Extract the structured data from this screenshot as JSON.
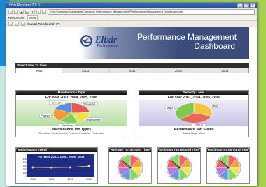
{
  "window": {
    "title": "iHub Reporter 7.0.0"
  },
  "toolbar": {
    "address": "Elixir/Samples/Dashboard/Corporate Performance Management/Performance Management Dashboard.pml"
  },
  "menus": [
    {
      "label": "Perspective"
    },
    {
      "label": "View"
    }
  ],
  "nav": {
    "label": "Overall Trends and KPI"
  },
  "header": {
    "brand": "Elixir",
    "brand_sub": "Technology",
    "title_line1": "Performance Management",
    "title_line2": "Dashboard"
  },
  "year_select": {
    "label": "Select Year To View",
    "years": [
      "2002",
      "2003",
      "2004",
      "2005",
      "2006"
    ]
  },
  "panels": {
    "maintenance_type": {
      "header": "Maintenance Type",
      "title": "For Year 2003, 2004, 2005, 2006",
      "subtitle": "Maintenance Job Types",
      "legend": "Corrective  Enhancement  Planned  Predictive  Preventive",
      "chart_data": {
        "type": "pie",
        "categories": [
          "Preventive",
          "Enhancement",
          "Predictive",
          "Planned",
          "Corrective"
        ],
        "values": [
          24,
          20,
          17,
          21,
          18
        ],
        "colors": [
          "#e85858",
          "#f0e34a",
          "#7bd45a",
          "#f39a3a",
          "#5a8fe0"
        ]
      }
    },
    "severity_level": {
      "header": "Severity Level",
      "title": "For Year 2003, 2004, 2005, 2006",
      "subtitle": "Maintenance Job Status",
      "legend": "Critical  Major  Minor",
      "chart_data": {
        "type": "pie",
        "categories": [
          "Minor",
          "Critical",
          "Major"
        ],
        "values": [
          30,
          34,
          36
        ],
        "colors": [
          "#f3c53e",
          "#e8665a",
          "#7fc94f"
        ]
      }
    },
    "maintenance_trend": {
      "header": "Maintenance Trend",
      "title": "For Year 2003, 2004, 2005, 2006",
      "chart_data": {
        "type": "line",
        "categories": [
          "2003",
          "2004",
          "2005",
          "2006"
        ],
        "values": [
          260,
          255,
          262,
          300
        ],
        "ylim": [
          0,
          500
        ],
        "yticks": [
          "500",
          "400",
          "300",
          "200",
          "100",
          "0"
        ]
      }
    },
    "gauges": [
      {
        "header": "Average Turnaround Time"
      },
      {
        "header": "Minimum Turnaround Time"
      },
      {
        "header": "Maximum Turnaround Time"
      }
    ]
  }
}
